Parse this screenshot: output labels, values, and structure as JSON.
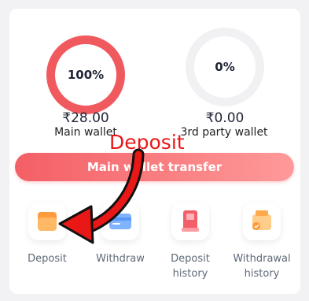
{
  "wallet": {
    "main": {
      "percent": "100%",
      "amount": "₹28.00",
      "label": "Main wallet"
    },
    "third_party": {
      "percent": "0%",
      "amount": "₹0.00",
      "label": "3rd party wallet"
    }
  },
  "transfer_button_label": "Main wallet transfer",
  "annotation": {
    "text": "Deposit"
  },
  "actions": [
    {
      "label": "Deposit",
      "icon": "wallet-icon"
    },
    {
      "label": "Withdraw",
      "icon": "card-icon"
    },
    {
      "label": "Deposit history",
      "icon": "bookmark-icon"
    },
    {
      "label": "Withdrawal history",
      "icon": "wallet-coin-icon"
    }
  ],
  "colors": {
    "accent": "#f05a5f",
    "annotation_red": "#ea1717"
  }
}
